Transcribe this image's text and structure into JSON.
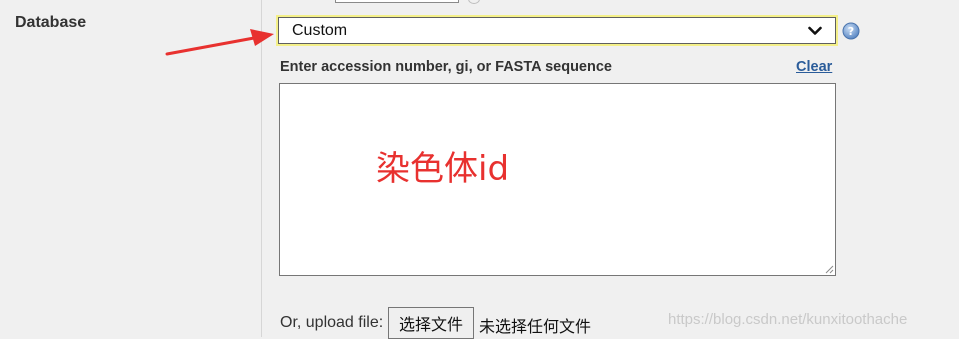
{
  "database": {
    "label": "Database",
    "selected": "Custom"
  },
  "accession": {
    "label": "Enter accession number, gi, or FASTA sequence",
    "clear_label": "Clear"
  },
  "annotation": {
    "text": "染色体id",
    "color": "#e8312f"
  },
  "upload": {
    "label": "Or, upload file:",
    "button_label": "选择文件",
    "no_file_text": "未选择任何文件"
  },
  "watermark": "https://blog.csdn.net/kunxitoothache",
  "icons": {
    "help": "help-icon",
    "dropdown": "chevron-down-icon",
    "arrow": "red-arrow-icon"
  },
  "colors": {
    "select_highlight": "#f4f089",
    "link": "#2a5c9a",
    "arrow": "#e8312f"
  }
}
